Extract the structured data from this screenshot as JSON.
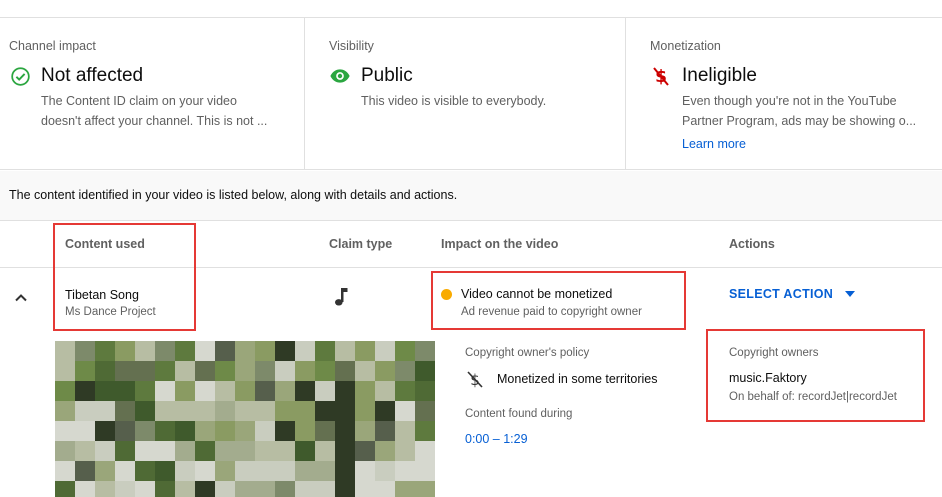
{
  "cards": [
    {
      "heading": "Channel impact",
      "value": "Not affected",
      "icon": "check-circle-icon",
      "icon_color": "#2ba640",
      "desc_lines": [
        "The Content ID claim on your video",
        "doesn't affect your channel. This is not ..."
      ]
    },
    {
      "heading": "Visibility",
      "value": "Public",
      "icon": "eye-icon",
      "icon_color": "#2ba640",
      "desc_lines": [
        "This video is visible to everybody."
      ]
    },
    {
      "heading": "Monetization",
      "value": "Ineligible",
      "icon": "dollar-off-icon",
      "icon_color": "#cc0000",
      "desc_lines": [
        "Even though you're not in the YouTube",
        "Partner Program, ads may be showing o..."
      ],
      "link": "Learn more"
    }
  ],
  "info_banner": "The content identified in your video is listed below, along with details and actions.",
  "table_headers": {
    "content_used": "Content used",
    "claim_type": "Claim type",
    "impact": "Impact on the video",
    "actions": "Actions"
  },
  "claim": {
    "title": "Tibetan Song",
    "subtitle": "Ms Dance Project",
    "claim_type_icon": "music-note-icon",
    "impact_title": "Video cannot be monetized",
    "impact_sub": "Ad revenue paid to copyright owner",
    "impact_color": "#f9ab00",
    "action_label": "SELECT ACTION",
    "policy_heading": "Copyright owner's policy",
    "policy_value": "Monetized in some territories",
    "found_heading": "Content found during",
    "found_range": "0:00 – 1:29",
    "owners_heading": "Copyright owners",
    "owner_name": "music.Faktory",
    "owner_behalf": "On behalf of: recordJet|recordJet"
  },
  "colors": {
    "accent_link": "#065fd4",
    "highlight": "#e53935"
  }
}
